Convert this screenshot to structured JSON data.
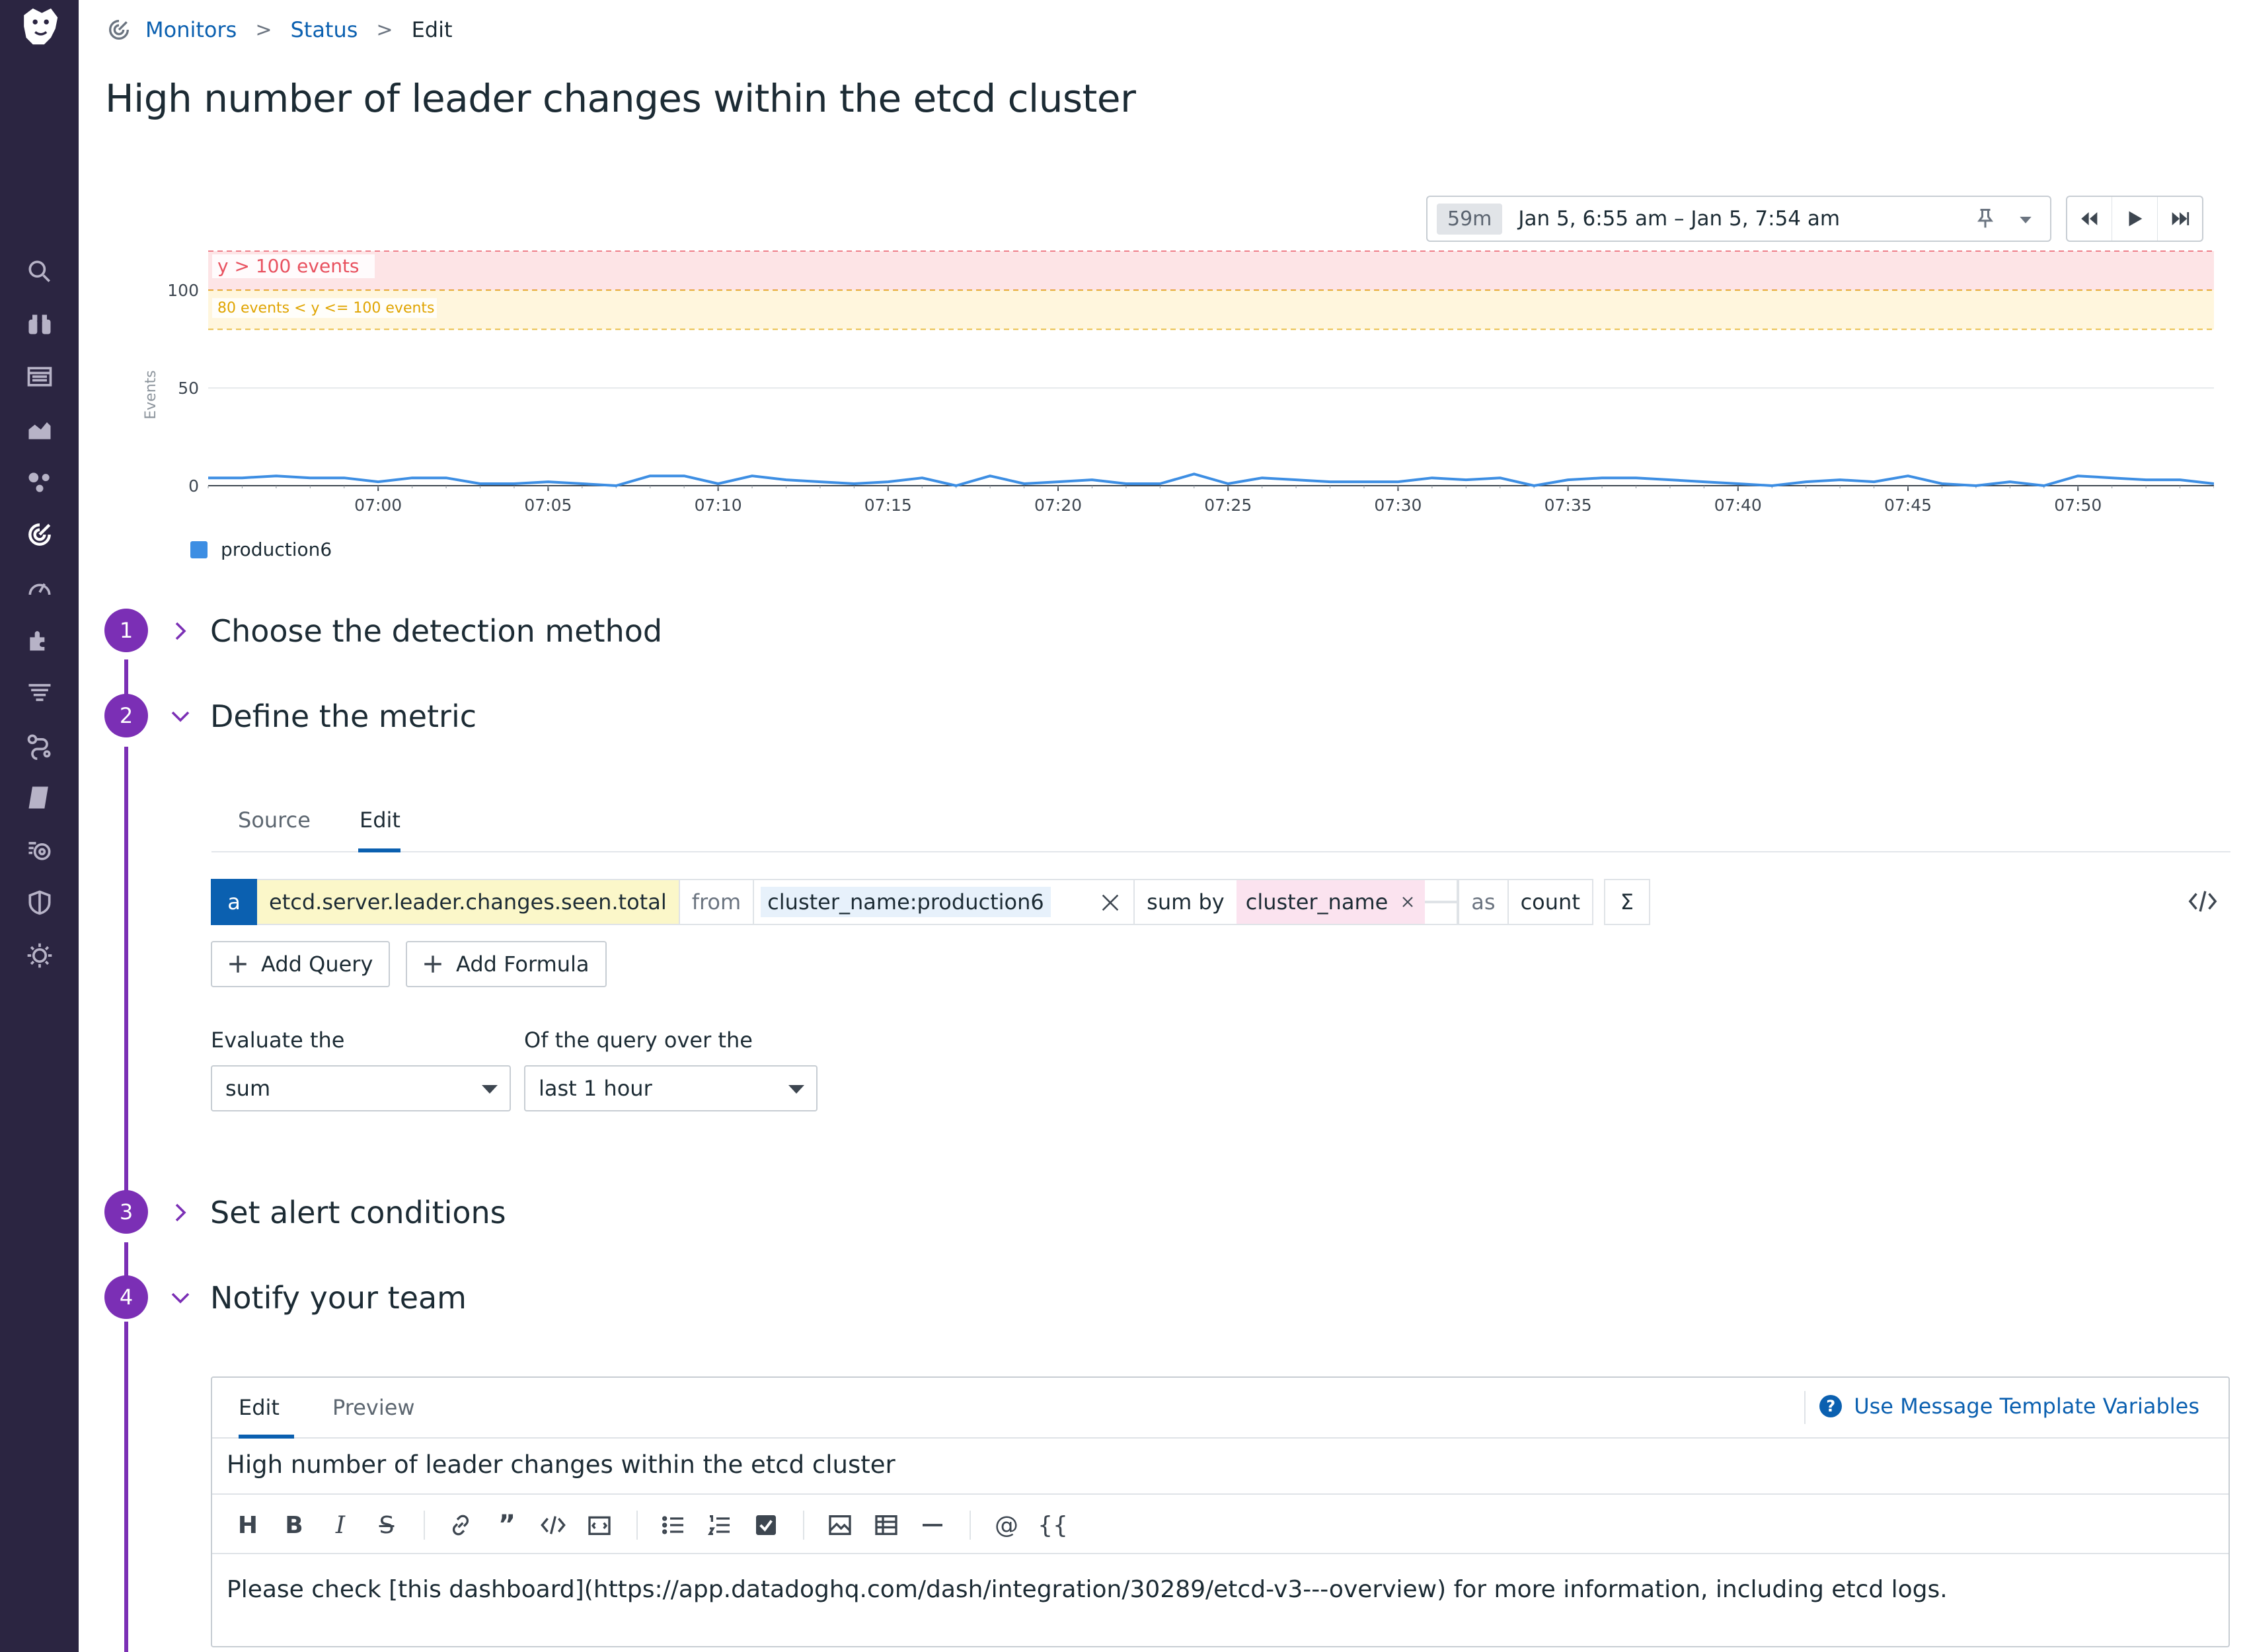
{
  "breadcrumb": {
    "items": [
      "Monitors",
      "Status"
    ],
    "current": "Edit"
  },
  "page_title": "High number of leader changes within the etcd cluster",
  "time_picker": {
    "badge": "59m",
    "range": "Jan 5, 6:55 am – Jan 5, 7:54 am"
  },
  "chart_data": {
    "type": "line",
    "ylabel": "Events",
    "yticks": [
      0,
      50,
      100
    ],
    "ylim": [
      0,
      120
    ],
    "x": [
      "06:55",
      "06:56",
      "06:57",
      "06:58",
      "06:59",
      "07:00",
      "07:01",
      "07:02",
      "07:03",
      "07:04",
      "07:05",
      "07:06",
      "07:07",
      "07:08",
      "07:09",
      "07:10",
      "07:11",
      "07:12",
      "07:13",
      "07:14",
      "07:15",
      "07:16",
      "07:17",
      "07:18",
      "07:19",
      "07:20",
      "07:21",
      "07:22",
      "07:23",
      "07:24",
      "07:25",
      "07:26",
      "07:27",
      "07:28",
      "07:29",
      "07:30",
      "07:31",
      "07:32",
      "07:33",
      "07:34",
      "07:35",
      "07:36",
      "07:37",
      "07:38",
      "07:39",
      "07:40",
      "07:41",
      "07:42",
      "07:43",
      "07:44",
      "07:45",
      "07:46",
      "07:47",
      "07:48",
      "07:49",
      "07:50",
      "07:51",
      "07:52",
      "07:53",
      "07:54"
    ],
    "xticks": [
      "07:00",
      "07:05",
      "07:10",
      "07:15",
      "07:20",
      "07:25",
      "07:30",
      "07:35",
      "07:40",
      "07:45",
      "07:50"
    ],
    "series": [
      {
        "name": "production6",
        "color": "#3d8ee3",
        "values": [
          4,
          4,
          5,
          4,
          4,
          2,
          4,
          4,
          1,
          1,
          2,
          1,
          0,
          5,
          5,
          1,
          5,
          3,
          2,
          1,
          2,
          4,
          0,
          5,
          1,
          2,
          3,
          1,
          1,
          6,
          1,
          4,
          3,
          2,
          2,
          2,
          4,
          3,
          4,
          0,
          3,
          4,
          4,
          3,
          2,
          1,
          0,
          2,
          3,
          2,
          5,
          1,
          0,
          2,
          0,
          5,
          4,
          3,
          3,
          1
        ]
      }
    ],
    "thresholds": [
      {
        "label": "y > 100 events",
        "min": 100,
        "max": 120,
        "color": "#e8515f",
        "fill": "#fde4e6"
      },
      {
        "label": "80 events < y <= 100 events",
        "min": 80,
        "max": 100,
        "color": "#e0a400",
        "fill": "#fff6dd"
      }
    ]
  },
  "steps": [
    {
      "number": "1",
      "title": "Choose the detection method",
      "expanded": false
    },
    {
      "number": "2",
      "title": "Define the metric",
      "expanded": true
    },
    {
      "number": "3",
      "title": "Set alert conditions",
      "expanded": false
    },
    {
      "number": "4",
      "title": "Notify your team",
      "expanded": true
    }
  ],
  "metric_tabs": [
    "Source",
    "Edit"
  ],
  "query": {
    "letter": "a",
    "metric": "etcd.server.leader.changes.seen.total",
    "from_label": "from",
    "from_tag": "cluster_name:production6",
    "sum_by_label": "sum by",
    "group_by": "cluster_name",
    "as_label": "as",
    "as_value": "count",
    "sigma": "Σ"
  },
  "buttons": {
    "add_query": "Add Query",
    "add_formula": "Add Formula"
  },
  "evaluate": {
    "label": "Evaluate the",
    "value": "sum",
    "window_label": "Of the query over the",
    "window_value": "last 1 hour"
  },
  "editor": {
    "tabs": [
      "Edit",
      "Preview"
    ],
    "help_link": "Use Message Template Variables",
    "subject": "High number of leader changes within the etcd cluster",
    "body": "Please check [this dashboard](https://app.datadoghq.com/dash/integration/30289/etcd-v3---overview) for more information, including etcd logs.",
    "toolbar": {
      "heading": "H",
      "bold": "B",
      "italic": "I",
      "strike": "S",
      "quote": "”",
      "mention": "@",
      "variable": "{{"
    }
  }
}
